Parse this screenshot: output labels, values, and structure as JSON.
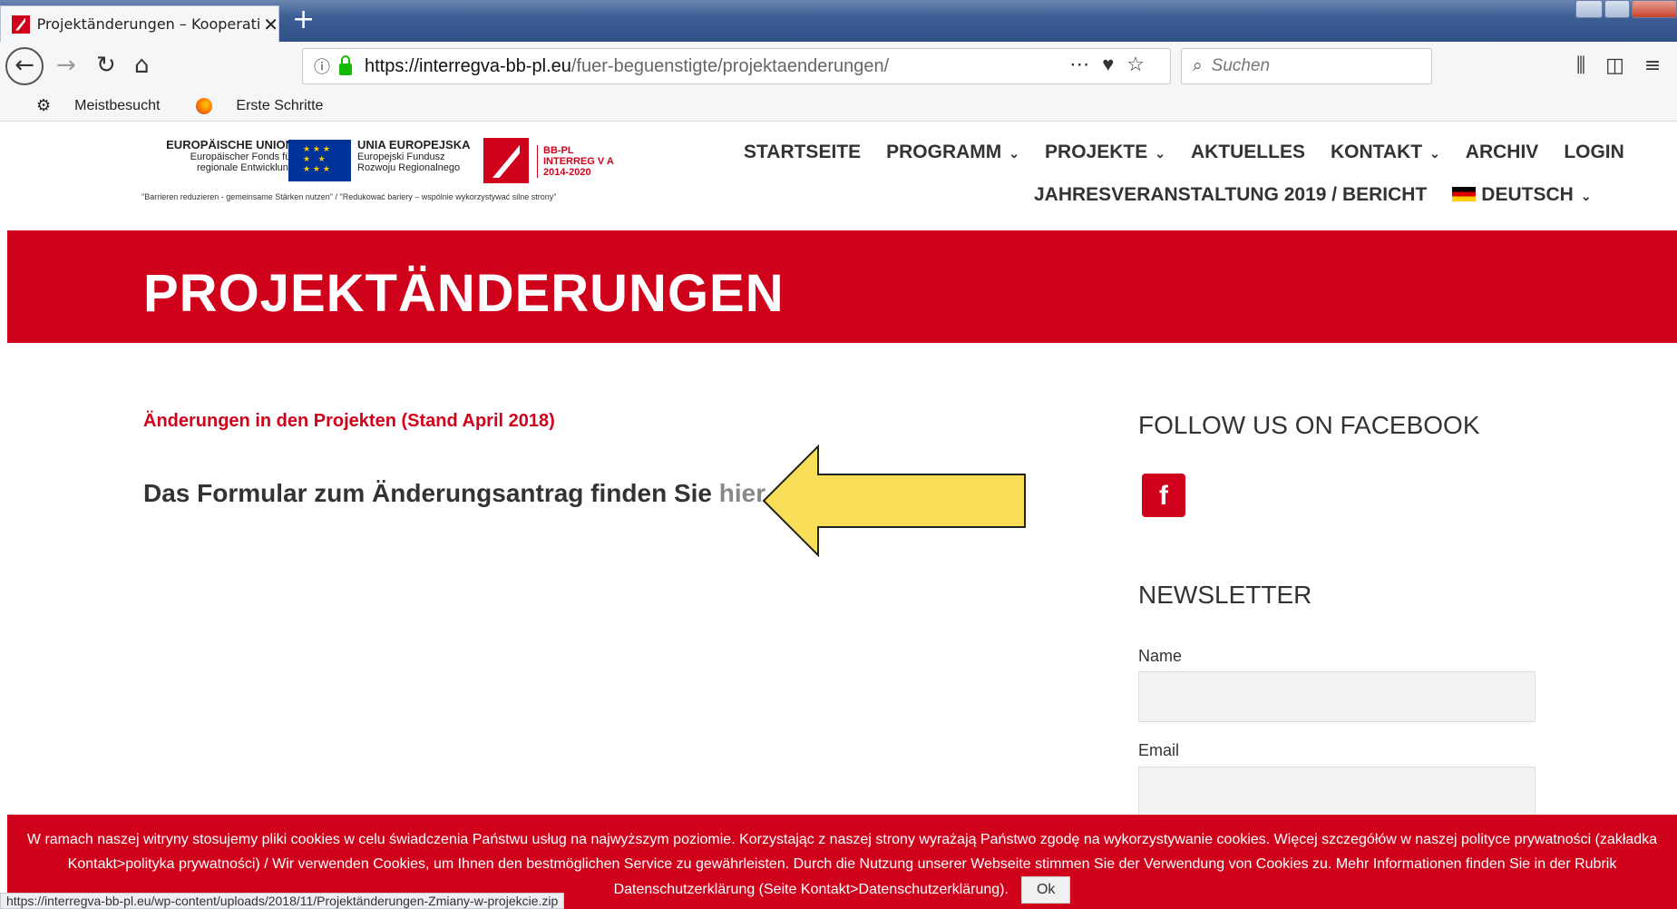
{
  "browser": {
    "tab_title": "Projektänderungen – Kooperati",
    "tab_close": "✕",
    "new_tab": "+",
    "url_host": "https://interregva-bb-pl.eu",
    "url_path": "/fuer-beguenstigte/projektaenderungen/",
    "search_placeholder": "Suchen",
    "bookmarks": [
      "Meistbesucht",
      "Erste Schritte"
    ],
    "status_url": "https://interregva-bb-pl.eu/wp-content/uploads/2018/11/Projektänderungen-Zmiany-w-projekcie.zip"
  },
  "logo": {
    "eu_title": "EUROPÄISCHE UNION",
    "eu_line2": "Europäischer Fonds für",
    "eu_line3": "regionale Entwicklung",
    "pl_title": "UNIA EUROPEJSKA",
    "pl_line2": "Europejski Fundusz",
    "pl_line3": "Rozwoju Regionalnego",
    "bbpl_1": "BB-PL",
    "bbpl_2": "INTERREG V A",
    "bbpl_3": "2014-2020",
    "motto": "\"Barrieren reduzieren - gemeinsame Stärken nutzen\" / \"Redukować bariery – wspólnie wykorzystywać silne strony\""
  },
  "nav": {
    "items": [
      "STARTSEITE",
      "PROGRAMM",
      "PROJEKTE",
      "AKTUELLES",
      "KONTAKT",
      "ARCHIV",
      "LOGIN"
    ],
    "sub_event": "JAHRESVERANSTALTUNG 2019 / BERICHT",
    "language": "DEUTSCH"
  },
  "page": {
    "title": "PROJEKTÄNDERUNGEN",
    "changes_link": "Änderungen in den Projekten (Stand April 2018)",
    "form_text": "Das Formular zum Änderungsantrag finden Sie ",
    "form_link": "hier",
    "form_end": "."
  },
  "sidebar": {
    "facebook_heading": "FOLLOW US ON FACEBOOK",
    "facebook_icon": "f",
    "newsletter_heading": "NEWSLETTER",
    "name_label": "Name",
    "email_label": "Email"
  },
  "cookie": {
    "text": "W ramach naszej witryny stosujemy pliki cookies w celu świadczenia Państwu usług na najwyższym poziomie. Korzystając z naszej strony wyrażają Państwo zgodę na wykorzystywanie cookies. Więcej szczegółów w naszej polityce prywatności (zakładka Kontakt>polityka prywatności) / Wir verwenden Cookies, um Ihnen den bestmöglichen Service zu gewährleisten. Durch die Nutzung unserer Webseite stimmen Sie der Verwendung von Cookies zu. Mehr Informationen finden Sie in der Rubrik Datenschutzerklärung (Seite Kontakt>Datenschutzerklärung).",
    "ok": "Ok"
  },
  "colors": {
    "brand_red": "#d0021b",
    "arrow_fill": "#f9de5a"
  }
}
